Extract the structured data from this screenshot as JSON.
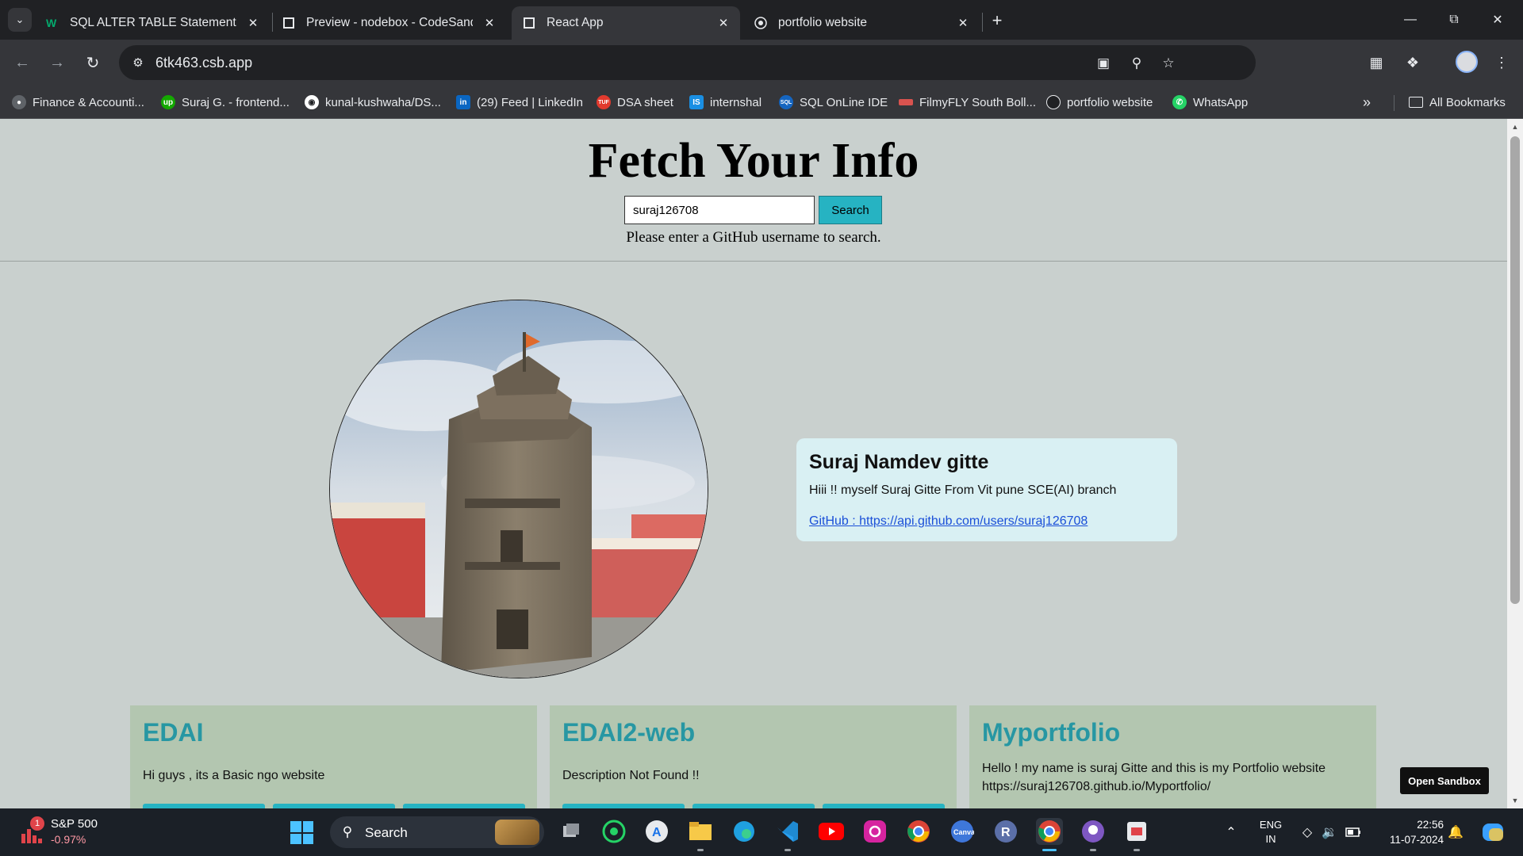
{
  "browser": {
    "tabs": [
      {
        "title": "SQL ALTER TABLE Statement",
        "favicon": "w3schools-icon",
        "active": false
      },
      {
        "title": "Preview - nodebox - CodeSandbox",
        "favicon": "codesandbox-icon",
        "active": false
      },
      {
        "title": "React App",
        "favicon": "codesandbox-icon",
        "active": true
      },
      {
        "title": "portfolio website",
        "favicon": "portfolio-icon",
        "active": false
      }
    ],
    "url": "6tk463.csb.app",
    "bookmarks": [
      {
        "label": "Finance & Accounti...",
        "icon": "globe-icon",
        "color": "#5f6368"
      },
      {
        "label": "Suraj G. - frontend...",
        "icon": "upwork-icon",
        "color": "#14a800"
      },
      {
        "label": "kunal-kushwaha/DS...",
        "icon": "github-icon",
        "color": "#ffffff"
      },
      {
        "label": "(29) Feed | LinkedIn",
        "icon": "linkedin-icon",
        "color": "#0a66c2"
      },
      {
        "label": "DSA sheet",
        "icon": "tuf-icon",
        "color": "#e23a2e"
      },
      {
        "label": "internshal",
        "icon": "internshala-icon",
        "color": "#1a8fe3"
      },
      {
        "label": "SQL OnLine IDE",
        "icon": "sql-icon",
        "color": "#1565c0"
      },
      {
        "label": "FilmyFLY South Boll...",
        "icon": "filmyfly-icon",
        "color": "#d9534f"
      },
      {
        "label": "portfolio website",
        "icon": "portfolio-icon",
        "color": "#202124"
      },
      {
        "label": "WhatsApp",
        "icon": "whatsapp-icon",
        "color": "#25d366"
      }
    ],
    "all_bookmarks_label": "All Bookmarks"
  },
  "app": {
    "title": "Fetch Your Info",
    "search_value": "suraj126708",
    "search_button": "Search",
    "prompt": "Please enter a GitHub username to search.",
    "profile": {
      "name": "Suraj Namdev gitte",
      "bio": "Hiii !! myself Suraj Gitte From Vit pune SCE(AI) branch",
      "link": "GitHub : https://api.github.com/users/suraj126708"
    },
    "repos": [
      {
        "name": "EDAI",
        "description": "Hi guys , its a Basic ngo website"
      },
      {
        "name": "EDAI2-web",
        "description": "Description Not Found !!"
      },
      {
        "name": "Myportfolio",
        "description": "Hello ! my name is suraj Gitte and this is my Portfolio website https://suraj126708.github.io/Myportfolio/"
      }
    ],
    "open_sandbox": "Open Sandbox"
  },
  "taskbar": {
    "stock_name": "S&P 500",
    "stock_change": "-0.97%",
    "stock_badge": "1",
    "search_label": "Search",
    "language_line1": "ENG",
    "language_line2": "IN",
    "time": "22:56",
    "date": "11-07-2024",
    "apps": [
      "task-view",
      "whatsapp",
      "app-store",
      "file-explorer",
      "edge",
      "vscode",
      "youtube",
      "instagram",
      "chrome",
      "canva",
      "r-app",
      "chrome-active",
      "github-desktop",
      "snipping-tool"
    ]
  },
  "colors": {
    "page_bg": "#c9d0ce",
    "accent": "#26b3c2",
    "repo_card_bg": "#b3c6b0",
    "profile_card_bg": "#d9f0f3",
    "link": "#1a4fd8"
  }
}
